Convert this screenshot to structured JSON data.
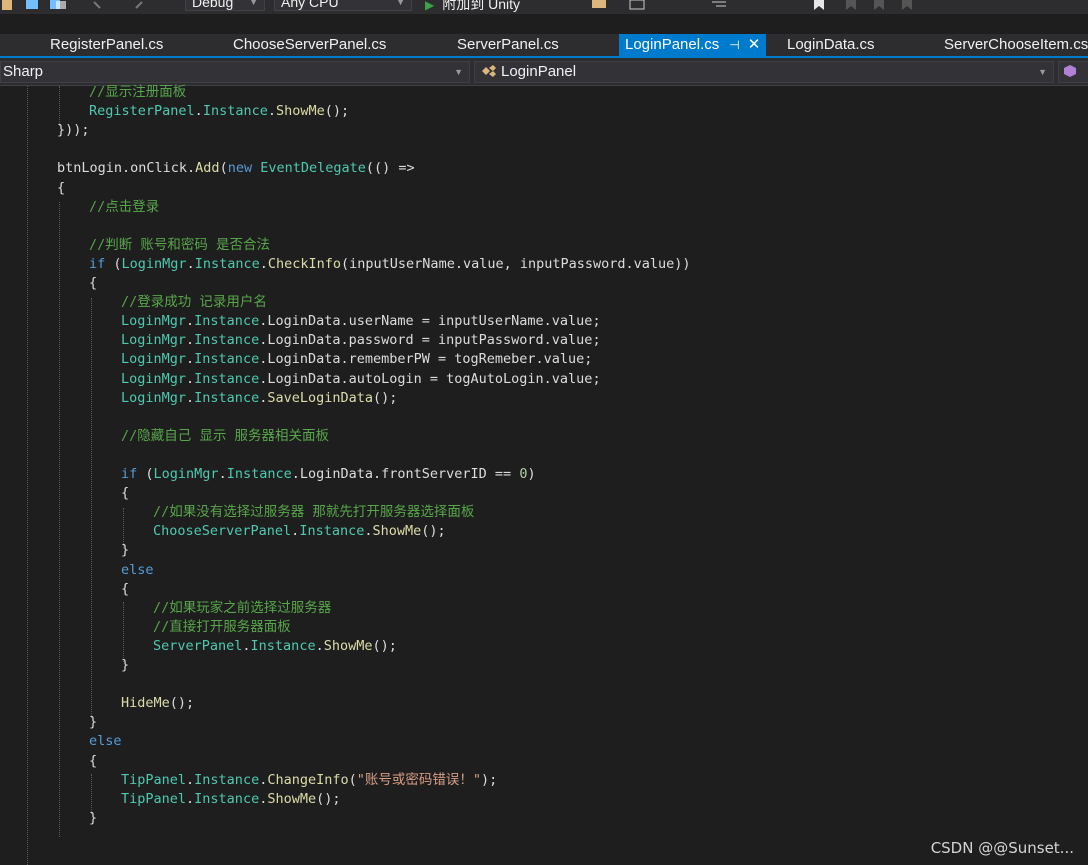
{
  "toolbar": {
    "config_value": "Debug",
    "platform_value": "Any CPU",
    "attach_label": "附加到 Unity"
  },
  "tabs": [
    {
      "label": "RegisterPanel.cs",
      "active": false
    },
    {
      "label": "ChooseServerPanel.cs",
      "active": false
    },
    {
      "label": "ServerPanel.cs",
      "active": false
    },
    {
      "label": "LoginPanel.cs",
      "active": true
    },
    {
      "label": "LoginData.cs",
      "active": false
    },
    {
      "label": "ServerChooseItem.cs",
      "active": false
    }
  ],
  "navbar": {
    "project": "Sharp",
    "type": "LoginPanel"
  },
  "code": [
    {
      "indent": 2,
      "tokens": [
        [
          "cm",
          "//显示注册面板"
        ]
      ]
    },
    {
      "indent": 2,
      "tokens": [
        [
          "ty",
          "RegisterPanel"
        ],
        [
          "tx",
          "."
        ],
        [
          "ty",
          "Instance"
        ],
        [
          "tx",
          "."
        ],
        [
          "mt",
          "ShowMe"
        ],
        [
          "tx",
          "();"
        ]
      ]
    },
    {
      "indent": 1,
      "tokens": [
        [
          "tx",
          "}));"
        ]
      ]
    },
    {
      "indent": 0,
      "tokens": []
    },
    {
      "indent": 1,
      "tokens": [
        [
          "tx",
          "btnLogin.onClick."
        ],
        [
          "mt",
          "Add"
        ],
        [
          "tx",
          "("
        ],
        [
          "kw",
          "new"
        ],
        [
          "tx",
          " "
        ],
        [
          "ty",
          "EventDelegate"
        ],
        [
          "tx",
          "(() =>"
        ]
      ]
    },
    {
      "indent": 1,
      "tokens": [
        [
          "tx",
          "{"
        ]
      ]
    },
    {
      "indent": 2,
      "tokens": [
        [
          "cm",
          "//点击登录"
        ]
      ]
    },
    {
      "indent": 0,
      "tokens": []
    },
    {
      "indent": 2,
      "tokens": [
        [
          "cm",
          "//判断 账号和密码 是否合法"
        ]
      ]
    },
    {
      "indent": 2,
      "tokens": [
        [
          "kw",
          "if"
        ],
        [
          "tx",
          " ("
        ],
        [
          "ty",
          "LoginMgr"
        ],
        [
          "tx",
          "."
        ],
        [
          "ty",
          "Instance"
        ],
        [
          "tx",
          "."
        ],
        [
          "mt",
          "CheckInfo"
        ],
        [
          "tx",
          "(inputUserName.value, inputPassword.value))"
        ]
      ]
    },
    {
      "indent": 2,
      "tokens": [
        [
          "tx",
          "{"
        ]
      ]
    },
    {
      "indent": 3,
      "tokens": [
        [
          "cm",
          "//登录成功 记录用户名"
        ]
      ]
    },
    {
      "indent": 3,
      "tokens": [
        [
          "ty",
          "LoginMgr"
        ],
        [
          "tx",
          "."
        ],
        [
          "ty",
          "Instance"
        ],
        [
          "tx",
          ".LoginData.userName = inputUserName.value;"
        ]
      ]
    },
    {
      "indent": 3,
      "tokens": [
        [
          "ty",
          "LoginMgr"
        ],
        [
          "tx",
          "."
        ],
        [
          "ty",
          "Instance"
        ],
        [
          "tx",
          ".LoginData.password = inputPassword.value;"
        ]
      ]
    },
    {
      "indent": 3,
      "tokens": [
        [
          "ty",
          "LoginMgr"
        ],
        [
          "tx",
          "."
        ],
        [
          "ty",
          "Instance"
        ],
        [
          "tx",
          ".LoginData.rememberPW = togRemeber.value;"
        ]
      ]
    },
    {
      "indent": 3,
      "tokens": [
        [
          "ty",
          "LoginMgr"
        ],
        [
          "tx",
          "."
        ],
        [
          "ty",
          "Instance"
        ],
        [
          "tx",
          ".LoginData.autoLogin = togAutoLogin.value;"
        ]
      ]
    },
    {
      "indent": 3,
      "tokens": [
        [
          "ty",
          "LoginMgr"
        ],
        [
          "tx",
          "."
        ],
        [
          "ty",
          "Instance"
        ],
        [
          "tx",
          "."
        ],
        [
          "mt",
          "SaveLoginData"
        ],
        [
          "tx",
          "();"
        ]
      ]
    },
    {
      "indent": 0,
      "tokens": []
    },
    {
      "indent": 3,
      "tokens": [
        [
          "cm",
          "//隐藏自己 显示 服务器相关面板"
        ]
      ]
    },
    {
      "indent": 0,
      "tokens": []
    },
    {
      "indent": 3,
      "tokens": [
        [
          "kw",
          "if"
        ],
        [
          "tx",
          " ("
        ],
        [
          "ty",
          "LoginMgr"
        ],
        [
          "tx",
          "."
        ],
        [
          "ty",
          "Instance"
        ],
        [
          "tx",
          ".LoginData.frontServerID == "
        ],
        [
          "nm",
          "0"
        ],
        [
          "tx",
          ")"
        ]
      ]
    },
    {
      "indent": 3,
      "tokens": [
        [
          "tx",
          "{"
        ]
      ]
    },
    {
      "indent": 4,
      "tokens": [
        [
          "cm",
          "//如果没有选择过服务器 那就先打开服务器选择面板"
        ]
      ]
    },
    {
      "indent": 4,
      "tokens": [
        [
          "ty",
          "ChooseServerPanel"
        ],
        [
          "tx",
          "."
        ],
        [
          "ty",
          "Instance"
        ],
        [
          "tx",
          "."
        ],
        [
          "mt",
          "ShowMe"
        ],
        [
          "tx",
          "();"
        ]
      ]
    },
    {
      "indent": 3,
      "tokens": [
        [
          "tx",
          "}"
        ]
      ]
    },
    {
      "indent": 3,
      "tokens": [
        [
          "kw",
          "else"
        ]
      ]
    },
    {
      "indent": 3,
      "tokens": [
        [
          "tx",
          "{"
        ]
      ]
    },
    {
      "indent": 4,
      "tokens": [
        [
          "cm",
          "//如果玩家之前选择过服务器"
        ]
      ]
    },
    {
      "indent": 4,
      "tokens": [
        [
          "cm",
          "//直接打开服务器面板"
        ]
      ]
    },
    {
      "indent": 4,
      "tokens": [
        [
          "ty",
          "ServerPanel"
        ],
        [
          "tx",
          "."
        ],
        [
          "ty",
          "Instance"
        ],
        [
          "tx",
          "."
        ],
        [
          "mt",
          "ShowMe"
        ],
        [
          "tx",
          "();"
        ]
      ]
    },
    {
      "indent": 3,
      "tokens": [
        [
          "tx",
          "}"
        ]
      ]
    },
    {
      "indent": 0,
      "tokens": []
    },
    {
      "indent": 3,
      "tokens": [
        [
          "mt",
          "HideMe"
        ],
        [
          "tx",
          "();"
        ]
      ]
    },
    {
      "indent": 2,
      "tokens": [
        [
          "tx",
          "}"
        ]
      ]
    },
    {
      "indent": 2,
      "tokens": [
        [
          "kw",
          "else"
        ]
      ]
    },
    {
      "indent": 2,
      "tokens": [
        [
          "tx",
          "{"
        ]
      ]
    },
    {
      "indent": 3,
      "tokens": [
        [
          "ty",
          "TipPanel"
        ],
        [
          "tx",
          "."
        ],
        [
          "ty",
          "Instance"
        ],
        [
          "tx",
          "."
        ],
        [
          "mt",
          "ChangeInfo"
        ],
        [
          "tx",
          "("
        ],
        [
          "st",
          "\"账号或密码错误！\""
        ],
        [
          "tx",
          ");"
        ]
      ]
    },
    {
      "indent": 3,
      "tokens": [
        [
          "ty",
          "TipPanel"
        ],
        [
          "tx",
          "."
        ],
        [
          "ty",
          "Instance"
        ],
        [
          "tx",
          "."
        ],
        [
          "mt",
          "ShowMe"
        ],
        [
          "tx",
          "();"
        ]
      ]
    },
    {
      "indent": 2,
      "tokens": [
        [
          "tx",
          "}"
        ]
      ]
    }
  ],
  "watermark": "CSDN @@Sunset...",
  "colors": {
    "accent": "#007acc",
    "comment": "#57a64a",
    "type": "#4ec9b0",
    "keyword": "#569cd6",
    "method": "#dcdcaa",
    "string": "#d69d85",
    "number": "#b5cea8"
  }
}
